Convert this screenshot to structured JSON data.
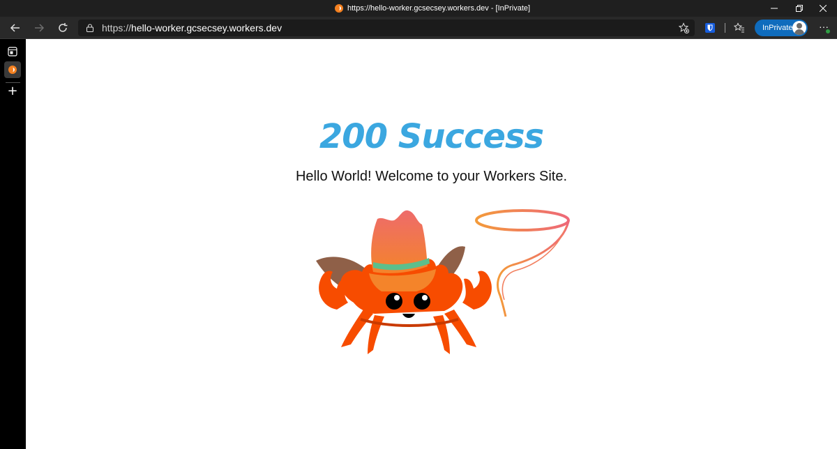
{
  "browser": {
    "window_title": "https://hello-worker.gcsecsey.workers.dev - [InPrivate]",
    "address_scheme": "https://",
    "address_host": "hello-worker.gcsecsey.workers.dev",
    "inprivate_label": "InPrivate",
    "more_label": "···",
    "icons": {
      "favicon": "cloudflare-favicon",
      "back": "back-arrow-icon",
      "forward": "forward-arrow-icon",
      "refresh": "refresh-icon",
      "lock": "lock-icon",
      "add_favorite": "star-plus-icon",
      "bitwarden": "shield-icon",
      "favorites": "favorites-icon",
      "tab_actions": "tab-actions-icon",
      "new_tab": "plus-icon"
    },
    "colors": {
      "titlebar": "#1f1f1f",
      "toolbar": "#292929",
      "accent": "#0f6cbd",
      "heading": "#3ba7e0",
      "crab": "#f74c00"
    }
  },
  "page": {
    "heading": "200 Success",
    "subtitle": "Hello World! Welcome to your Workers Site.",
    "mascot": "ferris-cowboy-crab-image"
  }
}
